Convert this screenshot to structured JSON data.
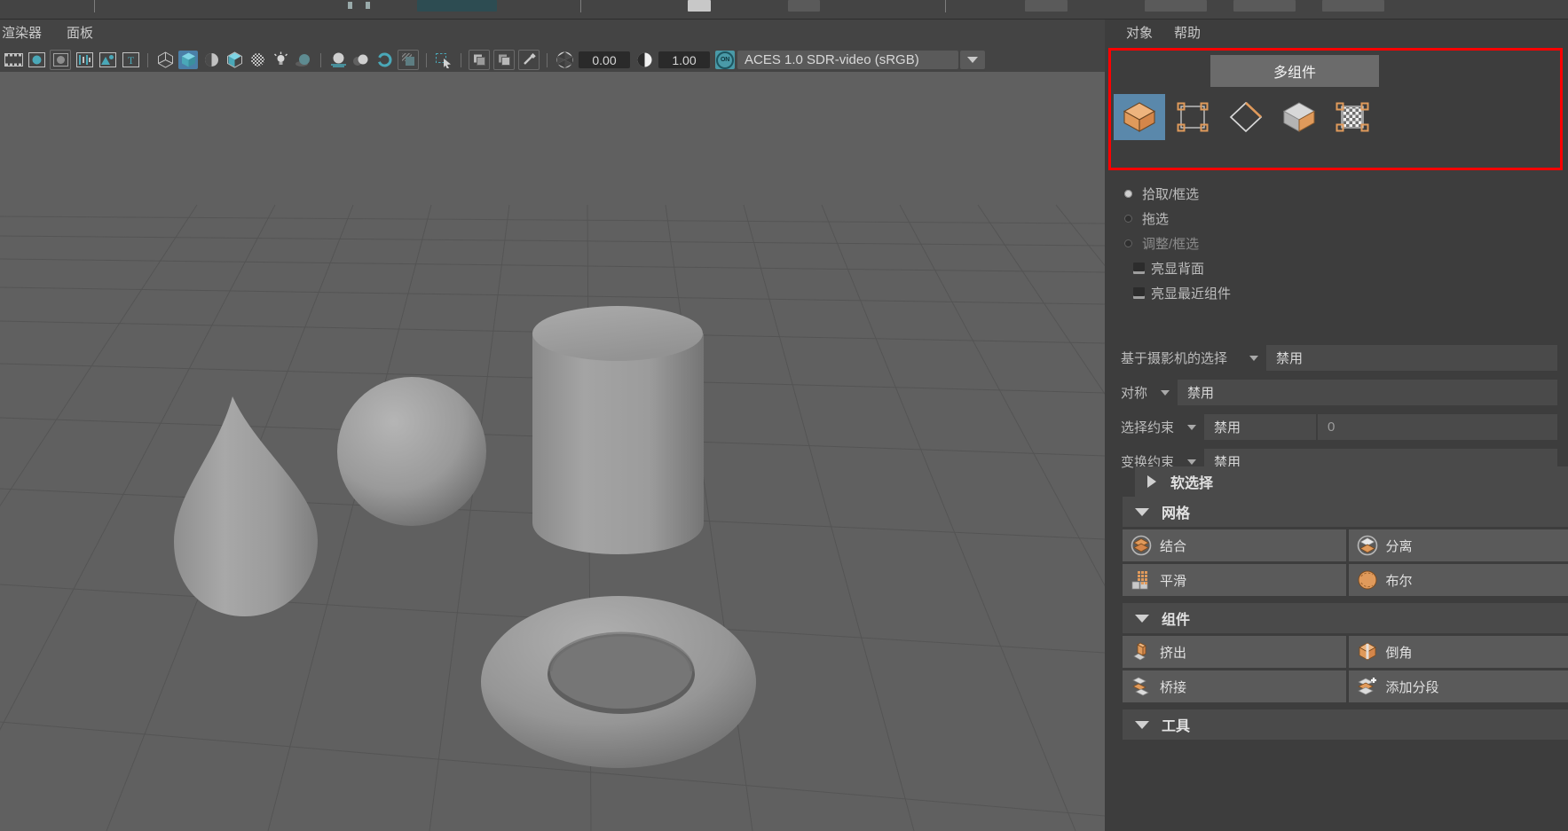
{
  "app": {
    "title": "3D Modeling Application Viewport",
    "accent_orange": "#E09A5B",
    "accent_blue": "#5A88AB",
    "accent_teal": "#4AA0AE",
    "highlight_red": "#FF0000",
    "panel_bg": "#3D3D3D",
    "viewport_bg": "#606060"
  },
  "menubar": {
    "items": [
      {
        "label": "渲染器",
        "name": "menu-renderer"
      },
      {
        "label": "面板",
        "name": "menu-panel"
      }
    ]
  },
  "toolbar": {
    "icons": [
      {
        "name": "film-strip-icon",
        "glyph": "film"
      },
      {
        "name": "render-current-frame-icon",
        "glyph": "circle-teal"
      },
      {
        "name": "ipr-render-icon",
        "glyph": "circle-grey-box"
      },
      {
        "name": "render-settings-icon",
        "glyph": "settings-bars"
      },
      {
        "name": "render-view-icon",
        "glyph": "image"
      },
      {
        "name": "text-tool-icon",
        "glyph": "T"
      },
      {
        "name": "wireframe-icon",
        "glyph": "wire-cube"
      },
      {
        "name": "smooth-shade-icon",
        "glyph": "solid-cube"
      },
      {
        "name": "shaded-lighting-icon",
        "glyph": "half-sphere"
      },
      {
        "name": "shaded-textured-icon",
        "glyph": "tex-cube"
      },
      {
        "name": "texture-checker-icon",
        "glyph": "checker-sphere"
      },
      {
        "name": "use-lights-icon",
        "glyph": "bulb"
      },
      {
        "name": "shadows-icon",
        "glyph": "shadow-sphere"
      },
      {
        "name": "ao-icon",
        "glyph": "ao-sphere"
      },
      {
        "name": "motion-blur-icon",
        "glyph": "motion-sphere"
      },
      {
        "name": "multisample-icon",
        "glyph": "ms-sphere"
      },
      {
        "name": "depth-of-field-icon",
        "glyph": "dof-ring"
      },
      {
        "name": "xray-mode-icon",
        "glyph": "xray-box"
      },
      {
        "name": "isolate-select-icon",
        "glyph": "marquee-arrow"
      },
      {
        "name": "layer-front-icon",
        "glyph": "layers-a"
      },
      {
        "name": "layer-back-icon",
        "glyph": "layers-b"
      },
      {
        "name": "eyedropper-icon",
        "glyph": "picker"
      }
    ],
    "exposure": {
      "icon": "aperture-icon",
      "value": "0.00",
      "name": "exposure-field"
    },
    "gamma": {
      "icon": "contrast-icon",
      "value": "1.00",
      "name": "gamma-field"
    },
    "color_toggle": {
      "label": "ON",
      "name": "color-management-toggle"
    },
    "color_profile": {
      "value": "ACES 1.0 SDR-video (sRGB)",
      "name": "color-profile-select"
    }
  },
  "viewport": {
    "objects": [
      "cone",
      "sphere",
      "cylinder",
      "torus"
    ],
    "grid": "perspective-ground-grid"
  },
  "right_panel": {
    "menu": [
      {
        "label": "对象",
        "name": "menu-object"
      },
      {
        "label": "帮助",
        "name": "menu-help"
      }
    ],
    "tab": {
      "label": "多组件",
      "name": "tab-multi-component"
    },
    "modes": [
      {
        "name": "mode-object",
        "icon": "orange-cube-icon",
        "active": true
      },
      {
        "name": "mode-vertex",
        "icon": "vertex-square-icon",
        "active": false
      },
      {
        "name": "mode-edge",
        "icon": "edge-diamond-icon",
        "active": false
      },
      {
        "name": "mode-face",
        "icon": "face-cube-icon",
        "active": false
      },
      {
        "name": "mode-uv",
        "icon": "uv-checker-icon",
        "active": false
      }
    ],
    "select_modes": [
      {
        "label": "拾取/框选",
        "name": "radio-pick-marquee",
        "selected": true,
        "disabled": false
      },
      {
        "label": "拖选",
        "name": "radio-drag-select",
        "selected": false,
        "disabled": false
      },
      {
        "label": "调整/框选",
        "name": "radio-tweak-marquee",
        "selected": false,
        "disabled": true
      }
    ],
    "checkboxes": [
      {
        "label": "亮显背面",
        "name": "checkbox-highlight-backfaces",
        "checked": true
      },
      {
        "label": "亮显最近组件",
        "name": "checkbox-highlight-nearest-component",
        "checked": true
      }
    ],
    "dropdown_rows": [
      {
        "label": "基于摄影机的选择",
        "name": "row-camera-based-selection",
        "value": "禁用",
        "extra": null
      },
      {
        "label": "对称",
        "name": "row-symmetry",
        "value": "禁用",
        "extra": null
      },
      {
        "label": "选择约束",
        "name": "row-selection-constraint",
        "value": "禁用",
        "extra": "0"
      },
      {
        "label": "变换约束",
        "name": "row-transform-constraint",
        "value": "禁用",
        "extra": null
      }
    ],
    "soft_selection": {
      "label": "软选择",
      "name": "section-soft-selection",
      "expanded": false
    },
    "sections": [
      {
        "title": "网格",
        "name": "section-mesh",
        "expanded": true,
        "items": [
          {
            "label": "结合",
            "name": "button-combine",
            "icon": "combine-icon"
          },
          {
            "label": "分离",
            "name": "button-separate",
            "icon": "separate-icon"
          },
          {
            "label": "平滑",
            "name": "button-smooth",
            "icon": "smooth-icon"
          },
          {
            "label": "布尔",
            "name": "button-boolean",
            "icon": "boolean-icon"
          }
        ]
      },
      {
        "title": "组件",
        "name": "section-component",
        "expanded": true,
        "items": [
          {
            "label": "挤出",
            "name": "button-extrude",
            "icon": "extrude-icon"
          },
          {
            "label": "倒角",
            "name": "button-bevel",
            "icon": "bevel-icon"
          },
          {
            "label": "桥接",
            "name": "button-bridge",
            "icon": "bridge-icon"
          },
          {
            "label": "添加分段",
            "name": "button-add-divisions",
            "icon": "add-divisions-icon"
          }
        ]
      },
      {
        "title": "工具",
        "name": "section-tools",
        "expanded": true,
        "items": []
      }
    ]
  }
}
